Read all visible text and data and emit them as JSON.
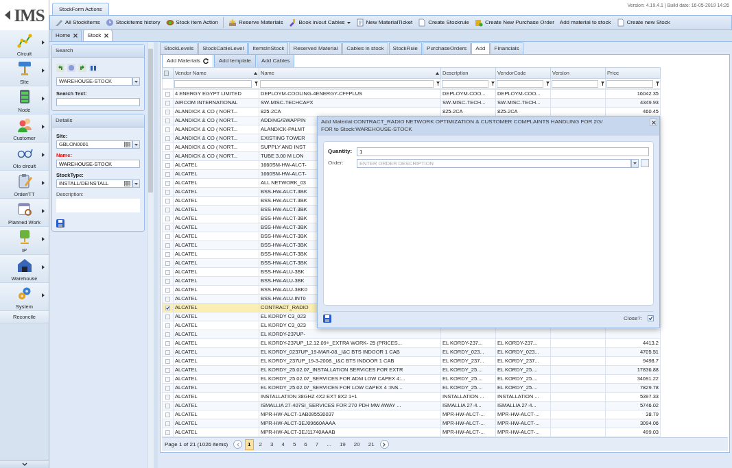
{
  "app": {
    "logo": "IMS",
    "version": "Version: 4.19.4.1 | Build date: 16-05-2019 14:26"
  },
  "nav": [
    {
      "label": "Circuit",
      "kind": "group"
    },
    {
      "label": "Site",
      "kind": "group"
    },
    {
      "label": "Node",
      "kind": "group"
    },
    {
      "label": "Customer",
      "kind": "group"
    },
    {
      "label": "Olo circuit",
      "kind": "group"
    },
    {
      "label": "Order/TT",
      "kind": "group"
    },
    {
      "label": "Planned Work",
      "kind": "group"
    },
    {
      "label": "IP",
      "kind": "group"
    },
    {
      "label": "Warehouse",
      "kind": "group"
    },
    {
      "label": "System",
      "kind": "group"
    },
    {
      "label": "Reconcile",
      "kind": "link"
    }
  ],
  "actions_tab": "StockForm Actions",
  "toolbar": [
    [
      {
        "label": "All StockItems",
        "icon": true,
        "dropdown": false
      },
      {
        "label": "Stockitems history",
        "icon": true,
        "dropdown": false
      },
      {
        "label": "Stock item Action",
        "icon": true,
        "dropdown": false
      }
    ],
    [
      {
        "label": "Reserve Materials",
        "icon": true,
        "dropdown": false
      },
      {
        "label": "Book in/out Cables",
        "icon": true,
        "dropdown": true
      },
      {
        "label": "New MaterialTicket",
        "icon": true,
        "dropdown": false
      },
      {
        "label": "Create Stockrule",
        "icon": true,
        "dropdown": false
      },
      {
        "label": "Create New Purchase Order",
        "icon": true,
        "dropdown": false
      },
      {
        "label": "Add material to stock",
        "icon": false,
        "dropdown": false
      },
      {
        "label": "Create new Stock",
        "icon": true,
        "dropdown": false
      }
    ]
  ],
  "doc_tabs": [
    {
      "label": "Home",
      "selected": false
    },
    {
      "label": "Stock",
      "selected": true
    }
  ],
  "search_panel": {
    "title": "Search",
    "stock": "WAREHOUSE-STOCK",
    "search_label": "Search Text:"
  },
  "details_panel": {
    "title": "Details",
    "fields": [
      {
        "label": "Site:",
        "kind": "combo",
        "value": "GBLON0001",
        "required": false
      },
      {
        "label": "Name:",
        "kind": "text",
        "value": "WAREHOUSE-STOCK",
        "required": true
      },
      {
        "label": "StockType:",
        "kind": "combo",
        "value": "INSTALL/DEINSTALL",
        "required": false
      },
      {
        "label": "Description:",
        "kind": "textarea",
        "required": false
      }
    ]
  },
  "grid_tabs": [
    {
      "label": "StockLevels",
      "selected": false
    },
    {
      "label": "StockCableLevel",
      "selected": false
    },
    {
      "label": "ItemsInStock",
      "selected": false
    },
    {
      "label": "Reserved Material",
      "selected": false
    },
    {
      "label": "Cables in stock",
      "selected": false
    },
    {
      "label": "StockRule",
      "selected": false
    },
    {
      "label": "PurchaseOrders",
      "selected": false
    },
    {
      "label": "Add",
      "selected": true
    },
    {
      "label": "Financials",
      "selected": false
    }
  ],
  "sub_tabs": [
    {
      "label": "Add Materials",
      "selected": true
    },
    {
      "label": "Add template",
      "selected": false
    },
    {
      "label": "Add Cables",
      "selected": false
    }
  ],
  "select_all": {
    "checked": false
  },
  "columns": [
    {
      "label": "Vendor Name",
      "sorted": true
    },
    {
      "label": "Name",
      "sorted": true
    },
    {
      "label": "Description",
      "sorted": false
    },
    {
      "label": "VendorCode",
      "sorted": false
    },
    {
      "label": "Version",
      "sorted": false
    },
    {
      "label": "Price",
      "sorted": false
    }
  ],
  "rows": [
    {
      "vendor": "4 ENERGY EGYPT LIMITED",
      "name": "DEPLOYM-COOLING-4ENERGY-CFFPLUS",
      "description": "DEPLOYM-COO...",
      "vendor_code": "DEPLOYM-COO...",
      "price": "16042.35",
      "selected": false
    },
    {
      "vendor": "AIRCOM INTERNATIONAL",
      "name": "SW-MISC-TECHCAPX",
      "description": "SW-MISC-TECH...",
      "vendor_code": "SW-MISC-TECH...",
      "price": "4349.93",
      "selected": false
    },
    {
      "vendor": "ALANDICK & CO ( NORT...",
      "name": "825-2CA",
      "description": "825-2CA",
      "vendor_code": "825-2CA",
      "price": "460.45",
      "selected": false
    },
    {
      "vendor": "ALANDICK & CO ( NORT...",
      "name": "ADDING/SWAPPIN",
      "selected": false
    },
    {
      "vendor": "ALANDICK & CO ( NORT...",
      "name": "ALANDICK-PALMT",
      "selected": false
    },
    {
      "vendor": "ALANDICK & CO ( NORT...",
      "name": "EXISTING TOWER",
      "selected": false
    },
    {
      "vendor": "ALANDICK & CO ( NORT...",
      "name": "SUPPLY AND INST",
      "selected": false
    },
    {
      "vendor": "ALANDICK & CO ( NORT...",
      "name": "TUBE 3.00 M LON",
      "selected": false
    },
    {
      "vendor": "ALCATEL",
      "name": "1660SM-HW-ALCT-",
      "selected": false
    },
    {
      "vendor": "ALCATEL",
      "name": "1660SM-HW-ALCT-",
      "selected": false
    },
    {
      "vendor": "ALCATEL",
      "name": "ALL NETWORK_03",
      "selected": false
    },
    {
      "vendor": "ALCATEL",
      "name": "BSS-HW-ALCT-3BK",
      "selected": false
    },
    {
      "vendor": "ALCATEL",
      "name": "BSS-HW-ALCT-3BK",
      "selected": false
    },
    {
      "vendor": "ALCATEL",
      "name": "BSS-HW-ALCT-3BK",
      "selected": false
    },
    {
      "vendor": "ALCATEL",
      "name": "BSS-HW-ALCT-3BK",
      "selected": false
    },
    {
      "vendor": "ALCATEL",
      "name": "BSS-HW-ALCT-3BK",
      "selected": false
    },
    {
      "vendor": "ALCATEL",
      "name": "BSS-HW-ALCT-3BK",
      "selected": false
    },
    {
      "vendor": "ALCATEL",
      "name": "BSS-HW-ALCT-3BK",
      "selected": false
    },
    {
      "vendor": "ALCATEL",
      "name": "BSS-HW-ALCT-3BK",
      "selected": false
    },
    {
      "vendor": "ALCATEL",
      "name": "BSS-HW-ALCT-3BK",
      "selected": false
    },
    {
      "vendor": "ALCATEL",
      "name": "BSS-HW-ALU-3BK",
      "selected": false
    },
    {
      "vendor": "ALCATEL",
      "name": "BSS-HW-ALU-3BK",
      "selected": false
    },
    {
      "vendor": "ALCATEL",
      "name": "BSS-HW-ALU-3BK0",
      "selected": false
    },
    {
      "vendor": "ALCATEL",
      "name": "BSS-HW-ALU-INT0",
      "selected": false
    },
    {
      "vendor": "ALCATEL",
      "name": "CONTRACT_RADIO",
      "selected": true
    },
    {
      "vendor": "ALCATEL",
      "name": "EL KORDY C3_023",
      "selected": false
    },
    {
      "vendor": "ALCATEL",
      "name": "EL KORDY C3_023",
      "selected": false
    },
    {
      "vendor": "ALCATEL",
      "name": "EL KORDY-237UP-",
      "selected": false
    },
    {
      "vendor": "ALCATEL",
      "name": "EL KORDY-237UP_12.12.09+_EXTRA WORK- 25 (PRICES...",
      "description": "EL KORDY-237...",
      "vendor_code": "EL KORDY-237...",
      "price": "4413.2",
      "selected": false
    },
    {
      "vendor": "ALCATEL",
      "name": "EL KORDY_0237UP_19-MAR-08._I&C BTS INDOOR 1 CAB",
      "description": "EL KORDY_023...",
      "vendor_code": "EL KORDY_023...",
      "price": "4705.51",
      "selected": false
    },
    {
      "vendor": "ALCATEL",
      "name": "EL KORDY_237UP_19-3-2008._I&C BTS INDOOR 1 CAB",
      "description": "EL KORDY_237...",
      "vendor_code": "EL KORDY_237...",
      "price": "9498.7",
      "selected": false
    },
    {
      "vendor": "ALCATEL",
      "name": "EL KORDY_25.02.07_INSTALLATION SERVICES FOR EXTR",
      "description": "EL KORDY_25....",
      "vendor_code": "EL KORDY_25....",
      "price": "17836.88",
      "selected": false
    },
    {
      "vendor": "ALCATEL",
      "name": "EL KORDY_25.02.07_SERVICES FOR ADM LOW CAPEX 4:...",
      "description": "EL KORDY_25....",
      "vendor_code": "EL KORDY_25....",
      "price": "34691.22",
      "selected": false
    },
    {
      "vendor": "ALCATEL",
      "name": "EL KORDY_25.02.07_SERVICES FOR LOW CAPEX 4 :INS...",
      "description": "EL KORDY_25....",
      "vendor_code": "EL KORDY_25....",
      "price": "7829.78",
      "selected": false
    },
    {
      "vendor": "ALCATEL",
      "name": "INSTALLATION 38GHZ 4X2 EXT 8X2 1+1",
      "description": "INSTALLATION ...",
      "vendor_code": "INSTALLATION ...",
      "price": "5397.33",
      "selected": false
    },
    {
      "vendor": "ALCATEL",
      "name": "ISMALLIA 27-407SI_SERVICES FOR 270 PDH MW AWAY ...",
      "description": "ISMALLIA 27-4...",
      "vendor_code": "ISMALLIA 27-4...",
      "price": "5746.02",
      "selected": false
    },
    {
      "vendor": "ALCATEL",
      "name": "MPR-HW-ALCT-1AB095530037",
      "description": "MPR-HW-ALCT-...",
      "vendor_code": "MPR-HW-ALCT-...",
      "price": "38.79",
      "selected": false
    },
    {
      "vendor": "ALCATEL",
      "name": "MPR-HW-ALCT-3EJ09660AAAA",
      "description": "MPR-HW-ALCT-...",
      "vendor_code": "MPR-HW-ALCT-...",
      "price": "3094.06",
      "selected": false
    },
    {
      "vendor": "ALCATEL",
      "name": "MPR-HW-ALCT-3EJ11740AAAB",
      "description": "MPR-HW-ALCT-...",
      "vendor_code": "MPR-HW-ALCT-...",
      "price": "499.03",
      "selected": false
    }
  ],
  "pager": {
    "summary": "Page 1 of 21 (1026 items)",
    "pages": [
      {
        "label": "1",
        "kind": "page",
        "selected": true
      },
      {
        "label": "2",
        "kind": "page",
        "selected": false
      },
      {
        "label": "3",
        "kind": "page",
        "selected": false
      },
      {
        "label": "4",
        "kind": "page",
        "selected": false
      },
      {
        "label": "5",
        "kind": "page",
        "selected": false
      },
      {
        "label": "6",
        "kind": "page",
        "selected": false
      },
      {
        "label": "7",
        "kind": "page",
        "selected": false
      },
      {
        "label": "...",
        "kind": "gap"
      },
      {
        "label": "19",
        "kind": "page",
        "selected": false
      },
      {
        "label": "20",
        "kind": "page",
        "selected": false
      },
      {
        "label": "21",
        "kind": "page",
        "selected": false
      }
    ]
  },
  "dialog": {
    "title": [
      "Add Material:CONTRACT_RADIO NETWORK OPTIMIZATION & CUSTOMER COMPLAINTS HANDLING FOR 2G/",
      "FOR to Stock:WAREHOUSE-STOCK"
    ],
    "quantity": {
      "label": "Quantity:",
      "value": "1"
    },
    "order": {
      "label": "Order:",
      "placeholder": "ENTER ORDER DESCRIPTION"
    },
    "close": {
      "label": "Close?:",
      "checked": true
    }
  }
}
